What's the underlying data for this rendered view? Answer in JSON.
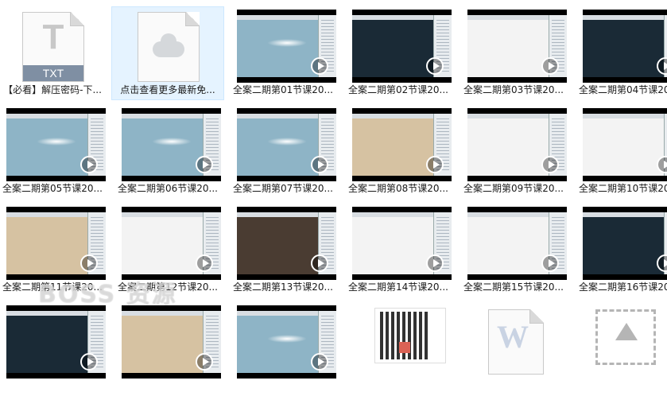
{
  "files": [
    {
      "label": "【必看】解压密码-下...",
      "kind": "txt",
      "ext": "TXT"
    },
    {
      "label": "点击查看更多最新免...",
      "kind": "cloud",
      "selected": true
    },
    {
      "label": "全案二期第01节课20...",
      "kind": "video",
      "screen": "blue"
    },
    {
      "label": "全案二期第02节课20...",
      "kind": "video",
      "screen": "dark"
    },
    {
      "label": "全案二期第03节课20...",
      "kind": "video",
      "screen": "white"
    },
    {
      "label": "全案二期第04节课20...",
      "kind": "video",
      "screen": "dark"
    },
    {
      "label": "全案二期第05节课20...",
      "kind": "video",
      "screen": "blue"
    },
    {
      "label": "全案二期第06节课20...",
      "kind": "video",
      "screen": "blue"
    },
    {
      "label": "全案二期第07节课20...",
      "kind": "video",
      "screen": "blue"
    },
    {
      "label": "全案二期第08节课20...",
      "kind": "video",
      "screen": "warm"
    },
    {
      "label": "全案二期第09节课20...",
      "kind": "video",
      "screen": "white"
    },
    {
      "label": "全案二期第10节课20...",
      "kind": "video",
      "screen": "white"
    },
    {
      "label": "全案二期第11节课20...",
      "kind": "video",
      "screen": "warm"
    },
    {
      "label": "全案二期第12节课20...",
      "kind": "video",
      "screen": "white"
    },
    {
      "label": "全案二期第13节课20...",
      "kind": "video",
      "screen": "photo"
    },
    {
      "label": "全案二期第14节课20...",
      "kind": "video",
      "screen": "white"
    },
    {
      "label": "全案二期第15节课20...",
      "kind": "video",
      "screen": "white"
    },
    {
      "label": "全案二期第16节课20...",
      "kind": "video",
      "screen": "dark"
    },
    {
      "label": "",
      "kind": "video",
      "screen": "dark"
    },
    {
      "label": "",
      "kind": "video",
      "screen": "warm"
    },
    {
      "label": "",
      "kind": "video",
      "screen": "blue"
    },
    {
      "label": "",
      "kind": "qr"
    },
    {
      "label": "",
      "kind": "word"
    },
    {
      "label": "",
      "kind": "upload"
    }
  ],
  "watermark": "BOSS 资源"
}
